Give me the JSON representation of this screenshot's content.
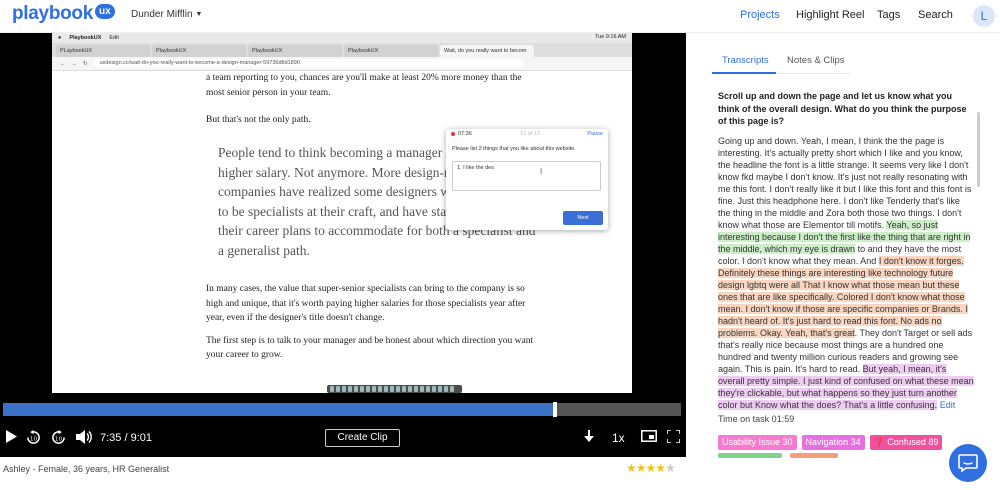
{
  "nav": {
    "brand": "playbook",
    "brand_badge": "ux",
    "org": "Dunder Mifflin",
    "links": {
      "projects": "Projects",
      "highlight_reel": "Highlight Reel",
      "tags": "Tags",
      "search": "Search"
    },
    "avatar_initial": "L"
  },
  "screen": {
    "mac_menu": {
      "app": "PlaybookUX",
      "edit": "Edit",
      "clock": "Tue 9:16 AM"
    },
    "tabs": [
      "PLaybookUX",
      "PlaybookUX",
      "PlaybookUX",
      "PlaybookUX",
      "Wait, do you really want to becom"
    ],
    "url": "uxdesign.cc/wait-do-you-really-want-to-become-a-design-manager-59736d8d1890",
    "article": {
      "p1": "a team reporting to you, chances are you'll make at least 20% more money than the most senior person in your team.",
      "p2": "But that's not the only path.",
      "quote": "People tend to think becoming a manager is the path to a higher salary. Not anymore. More design-mature companies have realized some designers want to continue to be specialists at their craft, and have started to adapt their career plans to accommodate for both a specialist and a generalist path.",
      "p3": "In many cases, the value that super-senior specialists can bring to the company is so high and unique, that it's worth paying higher salaries for those specialists year after year, even if the designer's title doesn't change.",
      "p4": "The first step is to talk to your manager and be honest about which direction you want your career to grow."
    },
    "modal": {
      "timer": "07:36",
      "counter": "12 of 13",
      "pause": "Pause",
      "question": "Please list 2 things that you like about this website.",
      "answer": "1. I like the des",
      "next": "Next"
    }
  },
  "player": {
    "progress": 0.8145,
    "current": "7:35",
    "separator": "/",
    "duration": "9:01",
    "create_clip": "Create Clip",
    "speed": "1x"
  },
  "participant": {
    "name": "Ashley",
    "details": "- Female, 36 years, HR Generalist",
    "rating": 4,
    "rating_max": 5
  },
  "panel": {
    "tabs": {
      "transcripts": "Transcripts",
      "notes": "Notes & Clips"
    },
    "question": "Scroll up and down the page and let us know what you think of the overall design. What do you think the purpose of this page is?",
    "transcript": {
      "t1": "Going up and down. Yeah, I mean, I think the the page is interesting. It's actually pretty short which I like and you know, the headline the font is a little strange. It seems very like I don't know fkd maybe I don't know. It's just not really resonating with me this font. I don't really like it but I like this font and this font is fine. Just this headphone here. I don't like Tenderly that's like the thing in the middle and Zora both those two things. I don't know what those are Elementor till motifs. ",
      "h1": "Yeah, so just interesting because I don't the first like the thing that are right in the middle, which my eye is drawn",
      "t2": " to and they have the most color. I don't know what they mean. And ",
      "h2": "I don't know it forges. Definitely these things are interesting like technology future design lgbtq were all That I know what those mean but these ones that are like specifically. Colored I don't know what those mean. I don't know if those are specific companies or Brands. I hadn't heard of. It's just hard to read this font. No ads no problems. Okay. Yeah, that's great",
      "t3": ". They don't Target or sell ads that's really nice because most things are a hundred one hundred and twenty million curious readers and growing see again. This is pain. It's hard to read. ",
      "h3": "But yeah, I mean, it's overall pretty simple. I just kind of confused on what these mean they're clickable, but what happens so they just turn another color but Know what the does? That's a little confusing.",
      "edit": " Edit"
    },
    "time_on_task": "Time on task 01:59",
    "tags": {
      "usability": "Usability Issue 30",
      "navigation": "Navigation 34",
      "confused": "❓ Confused 89"
    }
  },
  "colors": {
    "accent": "#2f6fe0",
    "progress": "#3b72c8",
    "star": "#f4c20d"
  }
}
